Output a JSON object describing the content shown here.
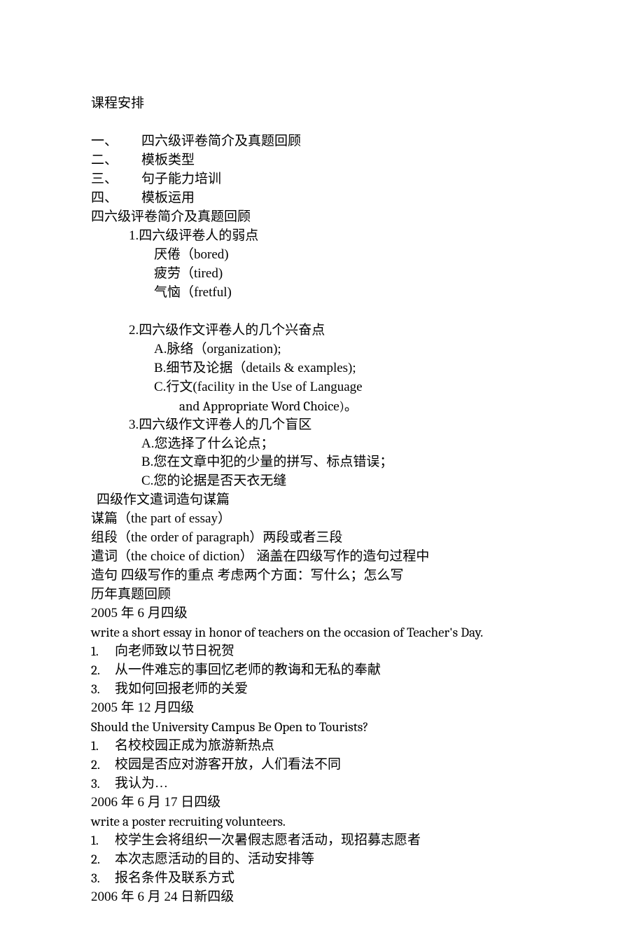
{
  "title": "课程安排",
  "outline": {
    "o1": {
      "num": "一、",
      "text": "四六级评卷简介及真题回顾"
    },
    "o2": {
      "num": "二、",
      "text": "模板类型"
    },
    "o3": {
      "num": "三、",
      "text": "句子能力培训"
    },
    "o4": {
      "num": "四、",
      "text": "模板运用"
    }
  },
  "sec1": {
    "heading": "四六级评卷简介及真题回顾",
    "p1": {
      "head": "1.四六级评卷人的弱点",
      "a": "厌倦（bored)",
      "b": "疲劳（tired)",
      "c": "气恼（fretful)"
    },
    "p2": {
      "head": "2.四六级作文评卷人的几个兴奋点",
      "a": "A.脉络（organization);",
      "b": "B.细节及论据（details & examples);",
      "c": "C.行文(facility in the Use of Language",
      "c2": "and Appropriate Word Choice)。"
    },
    "p3": {
      "head": "3.四六级作文评卷人的几个盲区",
      "a": "A.您选择了什么论点；",
      "b": "B.您在文章中犯的少量的拼写、标点错误；",
      "c": "C.您的论据是否天衣无缝"
    }
  },
  "sec2": {
    "heading": "四级作文遣词造句谋篇",
    "l1": "谋篇（the part of essay）",
    "l2": "组段（the order of paragraph）两段或者三段",
    "l3": "遣词（the choice of diction）  涵盖在四级写作的造句过程中",
    "l4": "造句    四级写作的重点    考虑两个方面：写什么；怎么写"
  },
  "sec3": {
    "heading": "历年真题回顾",
    "e1": {
      "date": "2005 年 6 月四级",
      "prompt": "write a short essay in honor of teachers on the occasion of Teacher's Day.",
      "n1": "1.",
      "t1": "向老师致以节日祝贺",
      "n2": "2.",
      "t2": "从一件难忘的事回忆老师的教诲和无私的奉献",
      "n3": "3.",
      "t3": "我如何回报老师的关爱"
    },
    "e2": {
      "date": "2005 年 12 月四级",
      "prompt": "Should the University Campus Be Open to Tourists?",
      "n1": "1.",
      "t1": "名校校园正成为旅游新热点",
      "n2": "2.",
      "t2": "校园是否应对游客开放，人们看法不同",
      "n3": "3.",
      "t3": "我认为…"
    },
    "e3": {
      "date": "2006 年 6 月 17 日四级",
      "prompt": "write a poster recruiting volunteers.",
      "n1": "1.",
      "t1": "校学生会将组织一次暑假志愿者活动，现招募志愿者",
      "n2": "2.",
      "t2": "本次志愿活动的目的、活动安排等",
      "n3": "3.",
      "t3": "报名条件及联系方式"
    },
    "e4": {
      "date": "2006 年 6 月 24 日新四级"
    }
  }
}
